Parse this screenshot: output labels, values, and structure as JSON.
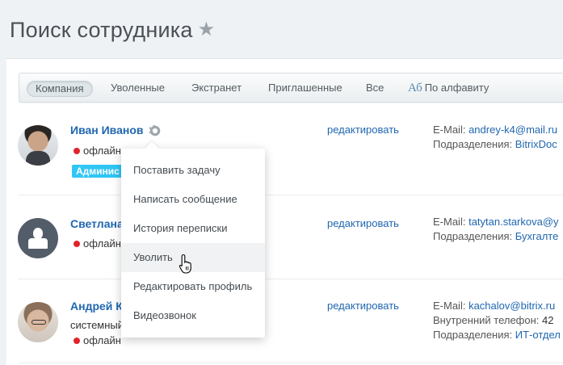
{
  "header": {
    "title": "Поиск сотрудника",
    "favorite_icon": "star-icon"
  },
  "filters": {
    "tabs": [
      {
        "label": "Компания",
        "active": true
      },
      {
        "label": "Уволенные",
        "active": false
      },
      {
        "label": "Экстранет",
        "active": false
      },
      {
        "label": "Приглашенные",
        "active": false
      },
      {
        "label": "Все",
        "active": false
      }
    ],
    "alphabet_icon_glyph": "Аб",
    "alphabet_label": "По алфавиту"
  },
  "users": [
    {
      "name": "Иван Иванов",
      "status": "офлайн",
      "badge": "Админис",
      "edit_label": "редактировать",
      "email_label": "E-Mail:",
      "email": "andrey-k4@mail.ru",
      "dept_label": "Подразделения:",
      "dept": "BitrixDoc"
    },
    {
      "name": "Светлана",
      "status": "офлайн",
      "edit_label": "редактировать",
      "email_label": "E-Mail:",
      "email": "tatytan.starkova@y",
      "dept_label": "Подразделения:",
      "dept": "Бухгалте"
    },
    {
      "name": "Андрей К",
      "subtitle": "системный",
      "status": "офлайн",
      "edit_label": "редактировать",
      "email_label": "E-Mail:",
      "email": "kachalov@bitrix.ru",
      "phone_label": "Внутренний телефон:",
      "phone": "42",
      "dept_label": "Подразделения:",
      "dept": "ИТ-отдел"
    }
  ],
  "context_menu": {
    "items": [
      {
        "label": "Поставить задачу"
      },
      {
        "label": "Написать сообщение"
      },
      {
        "label": "История переписки"
      },
      {
        "label": "Уволить",
        "hovered": true
      },
      {
        "label": "Редактировать профиль"
      },
      {
        "label": "Видеозвонок"
      }
    ]
  },
  "colors": {
    "link": "#2067b0",
    "offline_dot": "#e0242c",
    "badge": "#2fc6f6"
  }
}
